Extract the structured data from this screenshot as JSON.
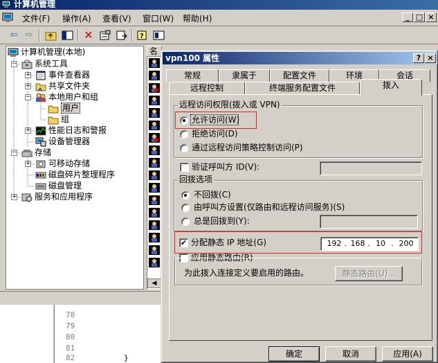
{
  "main_window": {
    "title": "计算机管理",
    "menu": [
      "文件(F)",
      "操作(A)",
      "查看(V)",
      "窗口(W)",
      "帮助(H)"
    ],
    "caption_buttons": [
      "_",
      "□",
      "×"
    ]
  },
  "tree": {
    "items": [
      {
        "label": "计算机管理(本地)",
        "icon": "computer-icon"
      },
      {
        "label": "系统工具",
        "icon": "tools-icon"
      },
      {
        "label": "事件查看器",
        "icon": "event-viewer-icon"
      },
      {
        "label": "共享文件夹",
        "icon": "folder-icon"
      },
      {
        "label": "本地用户和组",
        "icon": "users-icon"
      },
      {
        "label": "用户",
        "icon": "folder-icon"
      },
      {
        "label": "组",
        "icon": "folder-icon"
      },
      {
        "label": "性能日志和警报",
        "icon": "performance-icon"
      },
      {
        "label": "设备管理器",
        "icon": "device-manager-icon"
      },
      {
        "label": "存储",
        "icon": "storage-icon"
      },
      {
        "label": "可移动存储",
        "icon": "removable-storage-icon"
      },
      {
        "label": "磁盘碎片整理程序",
        "icon": "defrag-icon"
      },
      {
        "label": "磁盘管理",
        "icon": "disk-icon"
      },
      {
        "label": "服务和应用程序",
        "icon": "services-icon"
      }
    ]
  },
  "list": {
    "header": "名"
  },
  "code": {
    "lines": [
      "78",
      "79",
      "80",
      "81",
      "82"
    ],
    "brace": "}"
  },
  "dialog": {
    "title": "vpn100 属性",
    "caption_buttons": [
      "?",
      "×"
    ],
    "tabs_row1": [
      "常规",
      "隶属于",
      "配置文件",
      "环境",
      "会话"
    ],
    "tabs_row2": [
      "远程控制",
      "终端服务配置文件",
      "拨入"
    ],
    "active_tab": "拨入",
    "remote_access": {
      "group_label": "远程访问权限(拨入或 VPN)",
      "options": [
        "允许访问(W)",
        "拒绝访问(D)",
        "通过远程访问策略控制访问(P)"
      ],
      "selected": "允许访问(W)"
    },
    "verify_caller_id": {
      "label": "验证呼叫方 ID(V):",
      "checked": false,
      "value": ""
    },
    "callback": {
      "group_label": "回拨选项",
      "options": [
        "不回拨(C)",
        "由呼叫方设置(仅路由和远程访问服务)(S)",
        "总是回拨到(Y):"
      ],
      "selected": "不回拨(C)",
      "always_value": ""
    },
    "static_ip": {
      "label": "分配静态 IP 地址(G)",
      "checked": true,
      "octets": [
        "192",
        "168",
        "10",
        "200"
      ]
    },
    "static_route": {
      "label": "应用静态路由(R)",
      "checked": false,
      "description": "为此拨入连接定义要启用的路由。",
      "button": "静态路由(U)..."
    },
    "buttons": {
      "ok": "确定",
      "cancel": "取消",
      "apply": "应用(A)"
    },
    "highlight_color": "#e02020"
  }
}
